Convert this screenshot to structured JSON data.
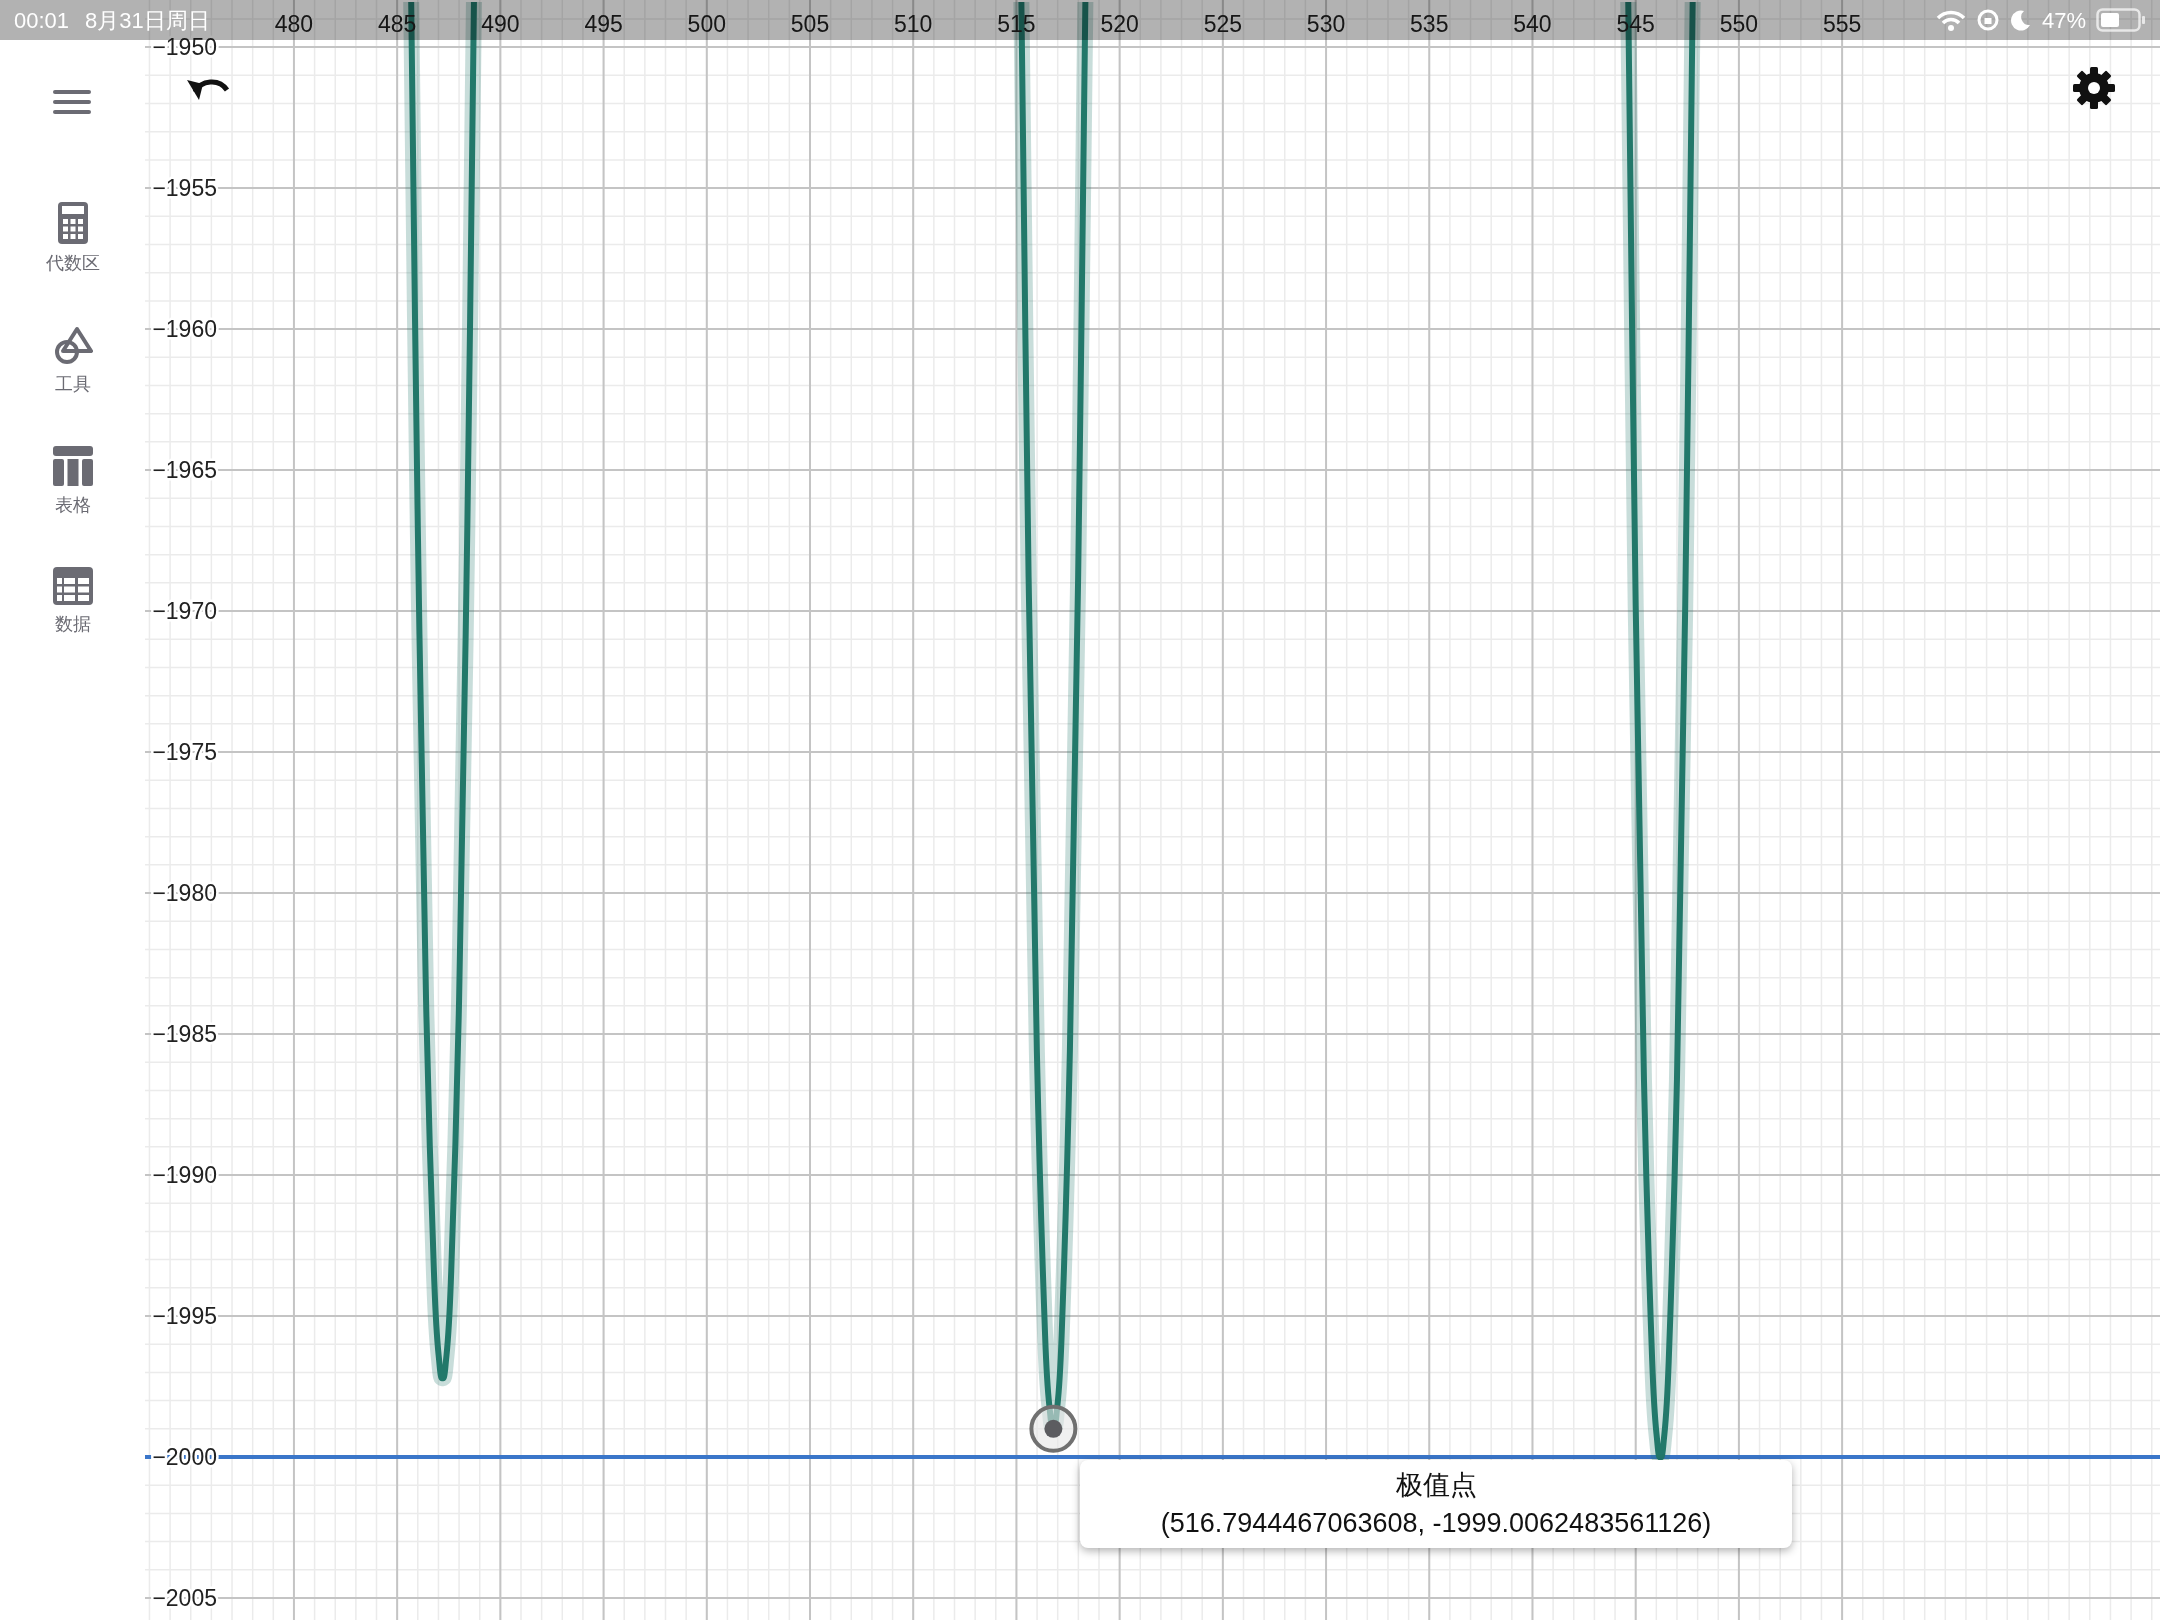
{
  "status_bar": {
    "time": "00:01",
    "date": "8月31日周日",
    "battery": "47%"
  },
  "sidebar": {
    "items": [
      {
        "label": "代数区",
        "kind": "calculator"
      },
      {
        "label": "工具",
        "kind": "shapes"
      },
      {
        "label": "表格",
        "kind": "table"
      },
      {
        "label": "数据",
        "kind": "spreadsheet"
      }
    ]
  },
  "graph": {
    "chart_data": {
      "type": "line",
      "xlim": [
        465.76,
        570.4
      ],
      "ylim": [
        -2005.78,
        -1948.33
      ],
      "xticks": [
        480,
        485,
        490,
        495,
        500,
        505,
        510,
        515,
        520,
        525,
        530,
        535,
        540,
        545,
        550,
        555
      ],
      "yticks": [
        {
          "value": -1950,
          "label": "−1950"
        },
        {
          "value": -1955,
          "label": "−1955"
        },
        {
          "value": -1960,
          "label": "−1960"
        },
        {
          "value": -1965,
          "label": "−1965"
        },
        {
          "value": -1970,
          "label": "−1970"
        },
        {
          "value": -1975,
          "label": "−1975"
        },
        {
          "value": -1980,
          "label": "−1980"
        },
        {
          "value": -1985,
          "label": "−1985"
        },
        {
          "value": -1990,
          "label": "−1990"
        },
        {
          "value": -1995,
          "label": "−1995"
        },
        {
          "value": -2000,
          "label": "−2000"
        },
        {
          "value": -2005,
          "label": "−2005"
        }
      ],
      "grid": true,
      "x": [
        485.68,
        486.0,
        486.4,
        486.8,
        487.05,
        487.2,
        487.35,
        487.6,
        488.0,
        488.4,
        488.72,
        515.24,
        515.59,
        515.99,
        516.39,
        516.64,
        516.79,
        516.94,
        517.19,
        517.59,
        517.99,
        518.34,
        544.64,
        545.0,
        545.4,
        545.8,
        546.05,
        546.2,
        546.35,
        546.6,
        547.0,
        547.4,
        547.76
      ],
      "series": [
        {
          "color": "#22786a",
          "values": [
            -1948.4,
            -1967.0,
            -1983.8,
            -1993.8,
            -1996.7,
            -1997.2,
            -1996.7,
            -1993.8,
            -1983.8,
            -1967.0,
            -1948.4,
            -1948.4,
            -1968.8,
            -1985.6,
            -1995.7,
            -1998.5,
            -1999.0,
            -1998.5,
            -1995.7,
            -1985.6,
            -1968.8,
            -1948.4,
            -1948.4,
            -1969.8,
            -1986.6,
            -1996.6,
            -1999.5,
            -2000.0,
            -1999.5,
            -1996.6,
            -1986.6,
            -1969.8,
            -1948.4
          ]
        },
        {
          "color": "#5c5c60",
          "marker": "circle",
          "values": [
            null,
            null,
            null,
            null,
            null,
            null,
            null,
            null,
            null,
            null,
            null,
            null,
            null,
            null,
            null,
            null,
            -1999.0,
            null,
            null,
            null,
            null,
            null,
            null,
            null,
            null,
            null,
            null,
            null,
            null,
            null,
            null,
            null,
            null
          ]
        }
      ],
      "ref_lines": [
        {
          "axis": "y",
          "value": -2000,
          "color": "#3a76c9"
        }
      ],
      "annotations": [
        "极值点"
      ]
    },
    "tooltip": {
      "coordinates": "(516.7944467063608, -1999.0062483561126)"
    }
  }
}
